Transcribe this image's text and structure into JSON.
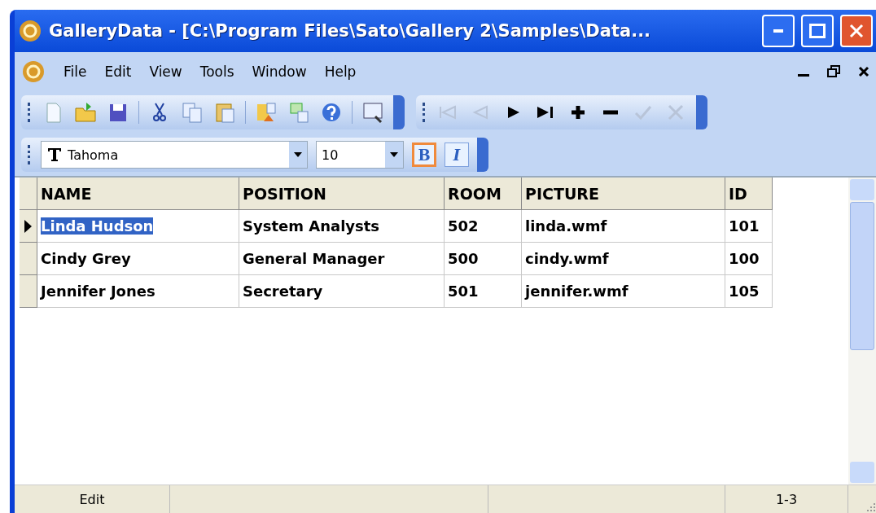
{
  "window": {
    "title": "GalleryData - [C:\\Program Files\\Sato\\Gallery 2\\Samples\\Data..."
  },
  "menu": [
    "File",
    "Edit",
    "View",
    "Tools",
    "Window",
    "Help"
  ],
  "nav_buttons": [
    {
      "disabled": true
    },
    {
      "disabled": true
    },
    {
      "disabled": false
    },
    {
      "disabled": false
    },
    {
      "disabled": false
    },
    {
      "disabled": false
    },
    {
      "disabled": true
    },
    {
      "disabled": true
    }
  ],
  "format_bar": {
    "font": "Tahoma",
    "size": "10",
    "bold": {
      "label": "B",
      "selected": true
    },
    "italic": {
      "label": "I",
      "selected": false
    }
  },
  "table": {
    "columns": [
      "NAME",
      "POSITION",
      "ROOM",
      "PICTURE",
      "ID"
    ],
    "rows": [
      {
        "current": true,
        "cells": [
          "Linda Hudson",
          "System Analysts",
          "502",
          "linda.wmf",
          "101"
        ]
      },
      {
        "current": false,
        "cells": [
          "Cindy Grey",
          "General Manager",
          "500",
          "cindy.wmf",
          "100"
        ]
      },
      {
        "current": false,
        "cells": [
          "Jennifer Jones",
          "Secretary",
          "501",
          "jennifer.wmf",
          "105"
        ]
      }
    ]
  },
  "status_bar": {
    "mode": "Edit",
    "range": "1-3"
  }
}
